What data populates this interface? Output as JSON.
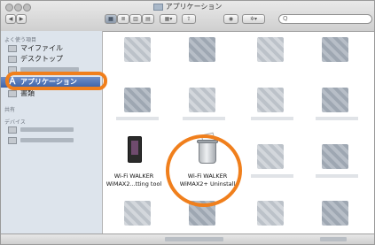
{
  "window": {
    "title": "アプリケーション"
  },
  "toolbar": {
    "back_label": "◀",
    "forward_label": "▶",
    "view_icon_label": "▦",
    "view_list_label": "≣",
    "view_column_label": "▥",
    "view_cover_label": "▤",
    "arrange_label": "▦▾",
    "share_label": "⇪",
    "quicklook_label": "◉",
    "action_label": "✲▾",
    "search_placeholder": "Q"
  },
  "sidebar": {
    "favorites_header": "よく使う項目",
    "items": [
      {
        "label": "マイファイル",
        "icon": "document-stack-icon"
      },
      {
        "label": "デスクトップ",
        "icon": "desktop-icon"
      },
      {
        "label": "",
        "icon": "blurred-item-icon"
      },
      {
        "label": "アプリケーション",
        "icon": "applications-icon",
        "selected": true
      },
      {
        "label": "書類",
        "icon": "documents-icon"
      }
    ],
    "shared_header": "共有",
    "devices_header": "デバイス"
  },
  "files": [
    {
      "label_line1": "Wi-Fi WALKER",
      "label_line2": "WiMAX2...tting tool",
      "icon": "router-icon"
    },
    {
      "label_line1": "Wi-Fi WALKER",
      "label_line2": "WiMAX2+ Uninstall",
      "icon": "trash-uninstaller-icon"
    }
  ],
  "colors": {
    "highlight": "#f07f1c",
    "selection": "#3e63a8",
    "sidebar_bg": "#dde4ec"
  }
}
